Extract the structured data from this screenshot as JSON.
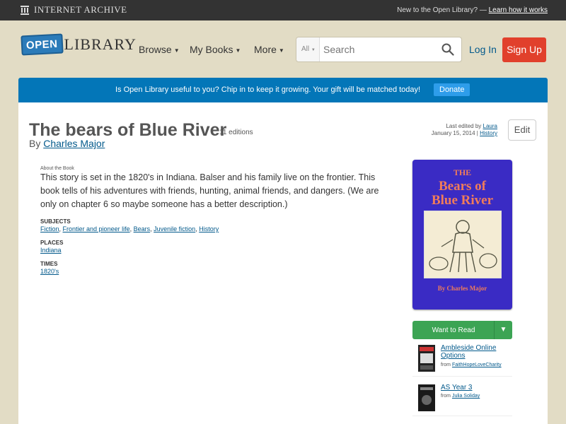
{
  "ia_bar": {
    "logo_text": "Internet Archive",
    "new_text": "New to the Open Library? —",
    "learn_link": "Learn how it works"
  },
  "header": {
    "logo_open": "OPEN",
    "logo_library": "LIBRARY",
    "nav": {
      "browse": "Browse",
      "my_books": "My Books",
      "more": "More"
    },
    "search": {
      "facet": "All",
      "placeholder": "Search"
    },
    "login": "Log In",
    "signup": "Sign Up"
  },
  "banner": {
    "message": "Is Open Library useful to you? Chip in to keep it growing. Your gift will be matched today!",
    "donate": "Donate"
  },
  "book": {
    "title": "The bears of Blue River",
    "editions": "11 editions",
    "by": "By",
    "author": "Charles Major",
    "last_edited_by": "Last edited by",
    "editor": "Laura",
    "edited_date": "January 15, 2014 |",
    "history": "History",
    "edit": "Edit",
    "about_label": "About the Book",
    "description": "This story is set in the 1820's in Indiana. Balser and his family live on the frontier. This book tells of his adventures with friends, hunting, animal friends, and dangers. (We are only on chapter 6 so maybe someone has a better description.)",
    "subjects_label": "Subjects",
    "subjects": [
      "Fiction",
      "Frontier and pioneer life",
      "Bears",
      "Juvenile fiction",
      "History"
    ],
    "places_label": "Places",
    "places": [
      "Indiana"
    ],
    "times_label": "Times",
    "times": [
      "1820's"
    ]
  },
  "cover": {
    "the": "THE",
    "title_line1": "Bears of",
    "title_line2": "Blue River",
    "author": "By Charles Major"
  },
  "sidebar": {
    "want_to_read": "Want to Read",
    "lists": [
      {
        "name": "Ambleside Online Options",
        "from": "from",
        "owner": "FaithHopeLoveCharity"
      },
      {
        "name": "AS Year 3",
        "from": "from",
        "owner": "Julia Soliday"
      }
    ]
  },
  "colors": {
    "ia_bar": "#333333",
    "background": "#e2dcc5",
    "banner": "#0376b8",
    "signup": "#e1402c",
    "want_to_read": "#3ca454",
    "link": "#02598b"
  }
}
